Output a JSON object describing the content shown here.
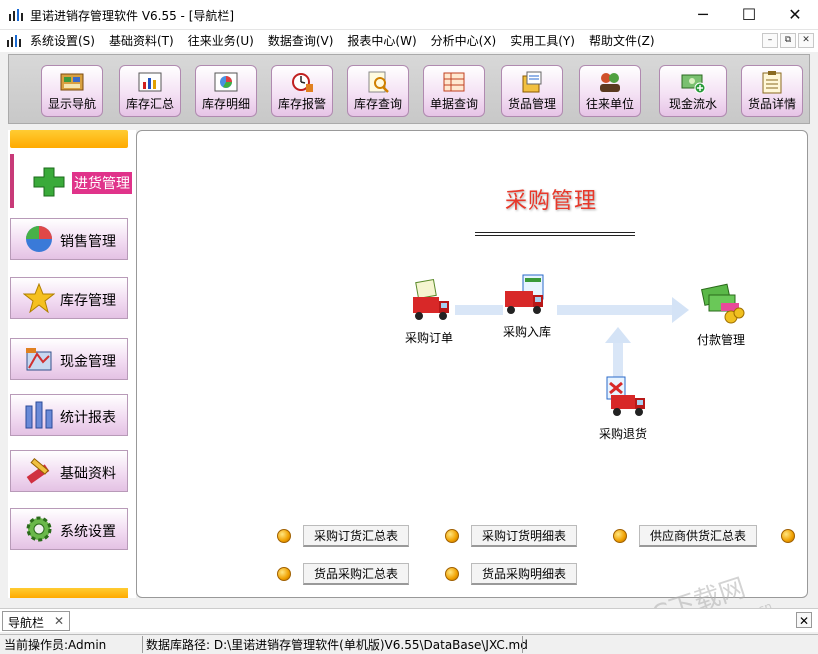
{
  "window": {
    "title": "里诺进销存管理软件 V6.55 - [导航栏]",
    "minimize_label": "─",
    "maximize_label": "☐",
    "close_label": "✕"
  },
  "menubar": {
    "items": [
      "系统设置(S)",
      "基础资料(T)",
      "往来业务(U)",
      "数据查询(V)",
      "报表中心(W)",
      "分析中心(X)",
      "实用工具(Y)",
      "帮助文件(Z)"
    ],
    "mdi_minimize": "–",
    "mdi_restore": "⧉",
    "mdi_close": "✕"
  },
  "toolbar": {
    "buttons": [
      {
        "label": "显示导航",
        "icon": "navigation-icon"
      },
      {
        "label": "库存汇总",
        "icon": "inventory-summary-icon"
      },
      {
        "label": "库存明细",
        "icon": "inventory-detail-icon"
      },
      {
        "label": "库存报警",
        "icon": "inventory-alarm-icon"
      },
      {
        "label": "库存查询",
        "icon": "inventory-query-icon"
      },
      {
        "label": "单据查询",
        "icon": "document-query-icon"
      },
      {
        "label": "货品管理",
        "icon": "goods-management-icon"
      },
      {
        "label": "往来单位",
        "icon": "partners-icon"
      },
      {
        "label": "现金流水",
        "icon": "cash-flow-icon"
      },
      {
        "label": "货品详情",
        "icon": "goods-detail-icon"
      }
    ]
  },
  "leftnav": {
    "active": {
      "label": "进货管理",
      "icon": "plus-icon"
    },
    "items": [
      {
        "label": "销售管理",
        "icon": "pie-icon"
      },
      {
        "label": "库存管理",
        "icon": "star-icon"
      },
      {
        "label": "现金管理",
        "icon": "cash-icon"
      },
      {
        "label": "统计报表",
        "icon": "bar-chart-icon"
      },
      {
        "label": "基础资料",
        "icon": "tools-icon"
      },
      {
        "label": "系统设置",
        "icon": "gear-icon"
      }
    ]
  },
  "main": {
    "heading": "采购管理",
    "flow": {
      "purchase_order": "采购订单",
      "purchase_receipt": "采购入库",
      "payment": "付款管理",
      "purchase_return": "采购退货"
    },
    "reports_row1": [
      "采购订货汇总表",
      "采购订货明细表",
      "供应商供货汇总表"
    ],
    "reports_row2": [
      "货品采购汇总表",
      "货品采购明细表"
    ]
  },
  "tabs": [
    {
      "label": "导航栏",
      "close": "✕"
    }
  ],
  "tab_close": "✕",
  "status": {
    "operator": "当前操作员:Admin",
    "db_path": "数据库路径: D:\\里诺进销存管理软件(单机版)V6.55\\DataBase\\JXC.md"
  },
  "watermark": {
    "main": "PC下载网",
    "url": "www.pcsoft.com.cn"
  },
  "colors": {
    "accent_magenta": "#e0338a",
    "heading_red": "#e8382a",
    "nav_gold": "#ffaa00",
    "button_pink": "#f3dff3"
  }
}
